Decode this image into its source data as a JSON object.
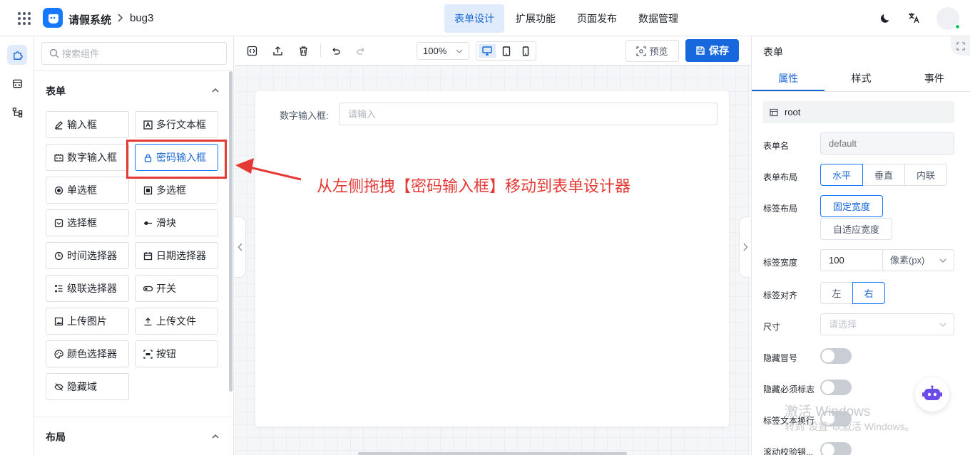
{
  "header": {
    "app_name": "请假系统",
    "page_name": "bug3",
    "tabs": [
      {
        "label": "表单设计",
        "active": true
      },
      {
        "label": "扩展功能",
        "active": false
      },
      {
        "label": "页面发布",
        "active": false
      },
      {
        "label": "数据管理",
        "active": false
      }
    ]
  },
  "component_panel": {
    "search_placeholder": "搜索组件",
    "form_section_title": "表单",
    "layout_section_title": "布局",
    "components": [
      {
        "label": "输入框",
        "icon": "edit-icon"
      },
      {
        "label": "多行文本框",
        "icon": "text-area-icon"
      },
      {
        "label": "数字输入框",
        "icon": "number-icon"
      },
      {
        "label": "密码输入框",
        "icon": "lock-icon",
        "highlighted": true
      },
      {
        "label": "单选框",
        "icon": "radio-icon"
      },
      {
        "label": "多选框",
        "icon": "checkbox-icon"
      },
      {
        "label": "选择框",
        "icon": "select-icon"
      },
      {
        "label": "滑块",
        "icon": "slider-icon"
      },
      {
        "label": "时间选择器",
        "icon": "clock-icon"
      },
      {
        "label": "日期选择器",
        "icon": "calendar-icon"
      },
      {
        "label": "级联选择器",
        "icon": "cascader-icon"
      },
      {
        "label": "开关",
        "icon": "switch-icon"
      },
      {
        "label": "上传图片",
        "icon": "image-icon"
      },
      {
        "label": "上传文件",
        "icon": "upload-icon"
      },
      {
        "label": "颜色选择器",
        "icon": "palette-icon"
      },
      {
        "label": "按钮",
        "icon": "button-icon"
      },
      {
        "label": "隐藏域",
        "icon": "eye-off-icon"
      }
    ]
  },
  "toolbar": {
    "zoom": "100%",
    "preview_label": "预览",
    "save_label": "保存"
  },
  "canvas": {
    "field_label": "数字输入框:",
    "field_placeholder": "请输入"
  },
  "annotation": {
    "text": "从左侧拖拽【密码输入框】移动到表单设计器"
  },
  "properties": {
    "title": "表单",
    "tabs": [
      {
        "label": "属性",
        "active": true
      },
      {
        "label": "样式",
        "active": false
      },
      {
        "label": "事件",
        "active": false
      }
    ],
    "root_label": "root",
    "form_name_label": "表单名",
    "form_name_value": "default",
    "form_layout_label": "表单布局",
    "form_layout_options": [
      "水平",
      "垂直",
      "内联"
    ],
    "label_layout_label": "标签布局",
    "label_layout_options": [
      "固定宽度",
      "自适应宽度"
    ],
    "label_width_label": "标签宽度",
    "label_width_value": "100",
    "label_width_unit": "像素(px)",
    "label_align_label": "标签对齐",
    "label_align_options": [
      "左",
      "右"
    ],
    "size_label": "尺寸",
    "size_placeholder": "请选择",
    "hide_colon_label": "隐藏冒号",
    "hide_required_label": "隐藏必须标志",
    "label_wrap_label": "标签文本换行",
    "scroll_validate_label": "滚动校验错..."
  },
  "watermark": {
    "line1": "激活 Windows",
    "line2": "转到\"设置\"以激活 Windows。"
  },
  "colors": {
    "primary": "#1668dc",
    "active_bg": "#e0ebfc",
    "annotation": "#e53935"
  }
}
